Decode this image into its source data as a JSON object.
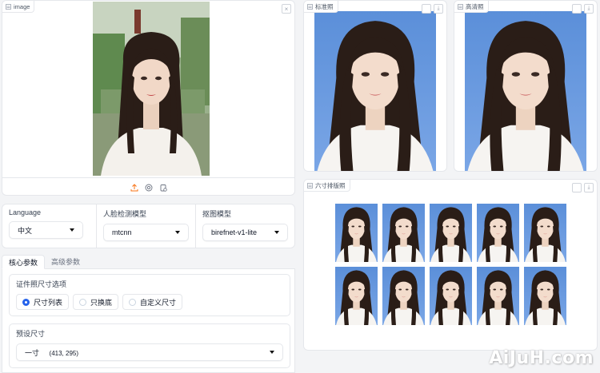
{
  "upload": {
    "label": "image",
    "close": "×"
  },
  "standard": {
    "label": "标准照"
  },
  "hd": {
    "label": "高清照"
  },
  "layout": {
    "label": "六寸排版照",
    "count": 10
  },
  "models": [
    {
      "label": "Language",
      "value": "中文"
    },
    {
      "label": "人脸检测模型",
      "value": "mtcnn"
    },
    {
      "label": "抠图模型",
      "value": "birefnet-v1-lite"
    }
  ],
  "tabs": {
    "core": "核心参数",
    "advanced": "高级参数"
  },
  "size_options": {
    "label": "证件照尺寸选项",
    "options": [
      "尺寸列表",
      "只换底",
      "自定义尺寸"
    ],
    "selected_index": 0
  },
  "preset": {
    "label": "预设尺寸",
    "value": "一寸",
    "dims": "(413, 295)"
  },
  "watermark": "AiJuH.com",
  "colors": {
    "accent": "#2563eb",
    "bg_blue": "#5b8fd9",
    "hair": "#2a1d17"
  }
}
